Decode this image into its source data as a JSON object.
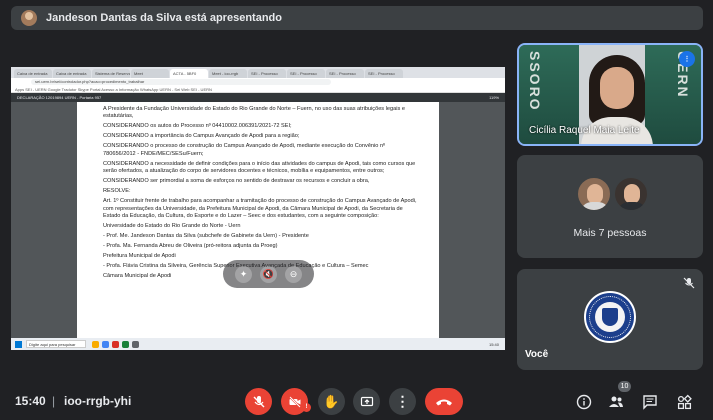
{
  "presenter": {
    "banner": "Jandeson Dantas da Silva está apresentando"
  },
  "browser": {
    "tabs": [
      "Caixa de entrada",
      "Caixa de entrada",
      "Sistema de Reservas",
      "Meet",
      "ACTA - 5BF0",
      "Meet - ioo-rrgb",
      "SEI - Processo",
      "SEI - Processo",
      "SEI - Processo",
      "SEI - Processo"
    ],
    "url": "sei.uern.br/sei/controlador.php?acao=procedimento_trabalhar",
    "bookmarks": "Apps   SEI - UERN   Google Tradutor   Skype   Portal   Acesso a Informação   WhatsApp   UERN - Sei Web   SEI - UERN",
    "pdf_name": "DECLARAÇÃO 12019894 UERN - Portaria 957",
    "pdf_zoom": "119%",
    "taskbar_search": "Digite aqui para pesquisar",
    "taskbar_time": "15:40"
  },
  "document": {
    "paragraphs": [
      "A Presidente da Fundação Universidade do Estado do Rio Grande do Norte – Fuern, no uso das suas atribuições legais e estatutárias,",
      "CONSIDERANDO os autos do Processo nº 04410002.006391/2021-72 SEI;",
      "CONSIDERANDO a importância do Campus Avançado de Apodi para a região;",
      "CONSIDERANDO o processo de construção do Campus Avançado de Apodi, mediante execução do Convênio nº 780656/2012 - FNDE/MEC/SESu/Fuern;",
      "CONSIDERANDO a necessidade de definir condições para o início das atividades do campus de Apodi, tais como cursos que serão ofertados, a atualização do corpo de servidores docentes e técnicos, mobília e equipamentos, entre outros;",
      "CONSIDERANDO ser primordial a soma de esforços no sentido de destravar os recursos e concluir a obra,",
      "RESOLVE:",
      "Art. 1º Constituir frente de trabalho para acompanhar a tramitação do processo de construção do Campus Avançado de Apodi, com representações da Universidade, da Prefeitura Municipal de Apodi, da Câmara Municipal de Apodi, da Secretaria de Estado da Educação, da Cultura, do Esporte e do Lazer – Seec e dos estudantes, com a seguinte composição:",
      "Universidade do Estado do Rio Grande do Norte - Uern",
      "- Prof. Me. Jandeson Dantas da Silva (subchefe de Gabinete da Uern) - Presidente",
      "- Profa. Ma. Fernanda Abreu de Oliveira (pró-reitora adjunta da Proeg)",
      "Prefeitura Municipal de Apodi",
      "- Profa. Flávia Cristina da Silveira, Gerência Superior Executiva Avançada de Educação e Cultura – Semec",
      "Câmara Municipal de Apodi"
    ]
  },
  "participants": {
    "pinned_name": "Cicília Raquel Maia Leite",
    "more_label": "Mais 7 pessoas",
    "self_label": "Você"
  },
  "meeting": {
    "time": "15:40",
    "separator": "|",
    "code": "ioo-rrgb-yhi",
    "people_count": "10",
    "alert_mark": "!"
  },
  "colors": {
    "background": "#202124",
    "tile": "#3c4043",
    "danger": "#ea4335",
    "accent": "#1a73e8",
    "active_border": "#8ab4f8"
  },
  "icons": [
    "mic-off-icon",
    "camera-off-icon",
    "raise-hand-icon",
    "present-icon",
    "more-vert-icon",
    "end-call-icon",
    "info-icon",
    "people-icon",
    "chat-icon",
    "activities-icon",
    "speaking-icon"
  ]
}
